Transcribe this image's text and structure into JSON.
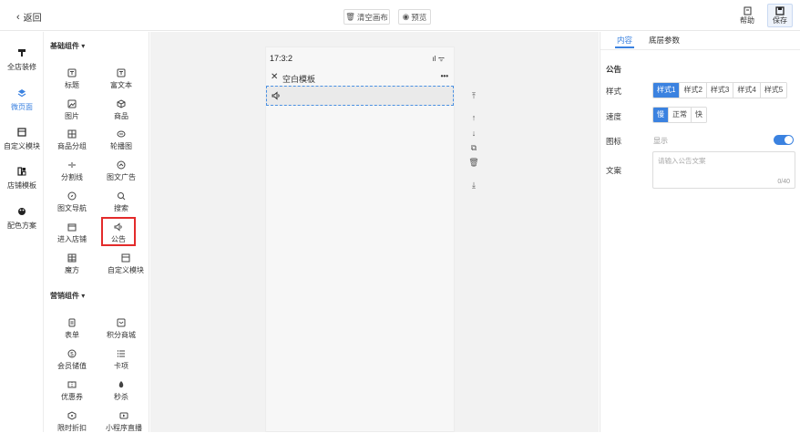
{
  "header": {
    "back_label": "返回",
    "clear_label": "清空画布",
    "preview_label": "预览",
    "help_label": "帮助",
    "save_label": "保存"
  },
  "leftnav": {
    "items": [
      {
        "label": "全店装修",
        "icon": "brush-icon",
        "active": false
      },
      {
        "label": "微页面",
        "icon": "layers-icon",
        "active": true
      },
      {
        "label": "自定义模块",
        "icon": "custom-module-icon",
        "active": false
      },
      {
        "label": "店铺模板",
        "icon": "template-icon",
        "active": false
      },
      {
        "label": "配色方案",
        "icon": "palette-icon",
        "active": false
      }
    ]
  },
  "palette": {
    "basic_title": "基础组件",
    "basic_items": [
      "标题",
      "富文本",
      "图片",
      "商品",
      "商品分组",
      "轮播图",
      "分割线",
      "图文广告",
      "图文导航",
      "搜索",
      "进入店铺",
      "公告",
      "魔方",
      "自定义模块"
    ],
    "marketing_title": "营销组件",
    "marketing_items": [
      "表单",
      "积分商城",
      "会员储值",
      "卡项",
      "优惠券",
      "秒杀",
      "限时折扣",
      "小程序直播"
    ]
  },
  "phone": {
    "time": "17:3:2",
    "page_title": "空白模板",
    "more": "•••"
  },
  "props": {
    "tabs": [
      "内容",
      "底层参数"
    ],
    "section_title": "公告",
    "style_label": "样式",
    "styles": [
      "样式1",
      "样式2",
      "样式3",
      "样式4",
      "样式5"
    ],
    "speed_label": "速度",
    "speeds": [
      "慢",
      "正常",
      "快"
    ],
    "icon_label": "图标",
    "icon_show": "显示",
    "text_label": "文案",
    "placeholder": "请输入公告文案",
    "counter": "0/40"
  },
  "colors": {
    "accent": "#3b82e0",
    "highlight_border": "#e32b2b"
  }
}
